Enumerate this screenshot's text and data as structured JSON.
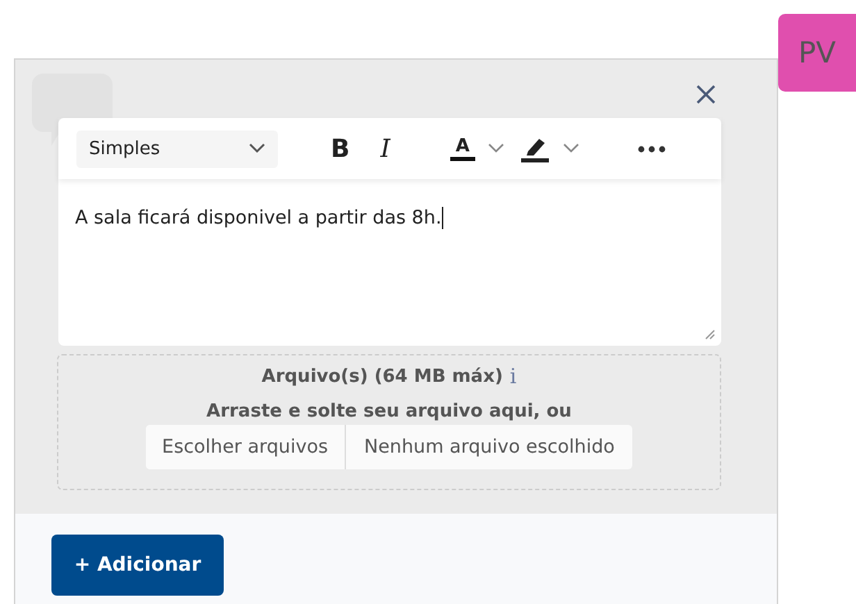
{
  "avatar": {
    "initials": "PV"
  },
  "toolbar": {
    "style_select": {
      "value": "Simples"
    },
    "bold": {
      "glyph": "B"
    },
    "italic": {
      "glyph": "I"
    },
    "font_color": {
      "glyph": "A"
    }
  },
  "editor": {
    "text": "A sala ficará disponivel a partir das 8h."
  },
  "attachments": {
    "title": "Arquivo(s) (64 MB máx)",
    "info": "i",
    "hint": "Arraste e solte seu arquivo aqui, ou",
    "choose_button": "Escolher arquivos",
    "file_status": "Nenhum arquivo escolhido"
  },
  "add_button": {
    "label": "+ Adicionar"
  }
}
